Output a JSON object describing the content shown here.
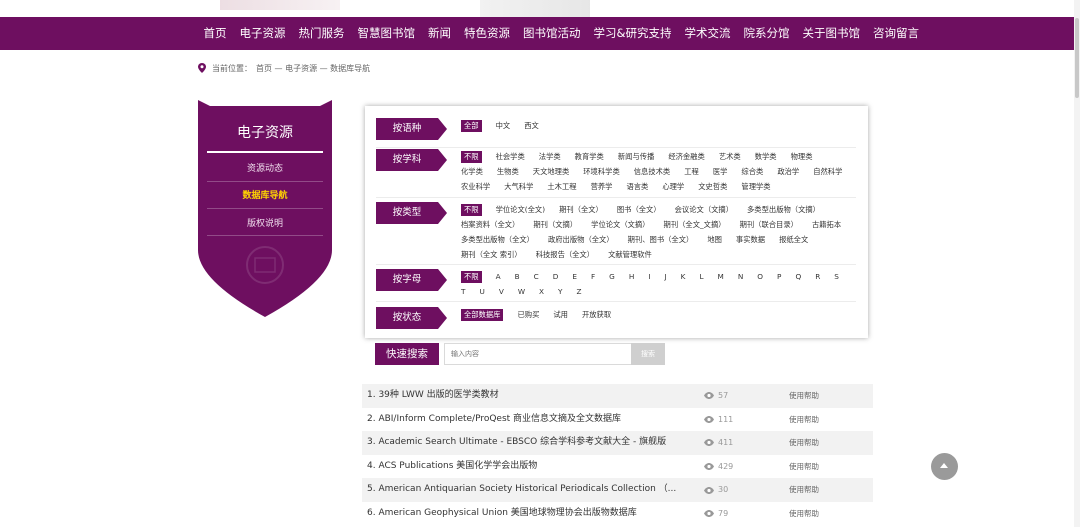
{
  "nav": [
    "首页",
    "电子资源",
    "热门服务",
    "智慧图书馆",
    "新闻",
    "特色资源",
    "图书馆活动",
    "学习&研究支持",
    "学术交流",
    "院系分馆",
    "关于图书馆",
    "咨询留言"
  ],
  "breadcrumb": {
    "prefix": "当前位置：",
    "path": "首页 — 电子资源 — 数据库导航"
  },
  "sidebar": {
    "title": "电子资源",
    "items": [
      {
        "label": "资源动态",
        "active": false
      },
      {
        "label": "数据库导航",
        "active": true
      },
      {
        "label": "版权说明",
        "active": false
      }
    ]
  },
  "filters": {
    "language": {
      "label": "按语种",
      "options": [
        "全部",
        "中文",
        "西文"
      ],
      "selected": "全部"
    },
    "subject": {
      "label": "按学科",
      "options": [
        "不限",
        "社会学类",
        "法学类",
        "教育学类",
        "新闻与传播",
        "经济金融类",
        "艺术类",
        "数学类",
        "物理类",
        "化学类",
        "生物类",
        "天文地理类",
        "环境科学类",
        "信息技术类",
        "工程",
        "医学",
        "综合类",
        "政治学",
        "自然科学",
        "农业科学",
        "大气科学",
        "土木工程",
        "营养学",
        "语言类",
        "心理学",
        "文史哲类",
        "管理学类"
      ],
      "selected": "不限"
    },
    "type": {
      "label": "按类型",
      "options": [
        "不限",
        "学位论文(全文)",
        "期刊（全文）",
        "图书（全文）",
        "会议论文（文摘）",
        "多类型出版物（文摘）",
        "档案资料（全文）",
        "期刊（文摘）",
        "学位论文（文摘）",
        "期刊（全文_文摘）",
        "期刊（联合目录）",
        "古籍拓本",
        "多类型出版物（全文）",
        "政府出版物（全文）",
        "期刊、图书（全文）",
        "地图",
        "事实数据",
        "报纸全文",
        "期刊（全文 索引）",
        "科技报告（全文）",
        "文献管理软件"
      ],
      "selected": "不限"
    },
    "letter": {
      "label": "按字母",
      "options": [
        "不限",
        "A",
        "B",
        "C",
        "D",
        "E",
        "F",
        "G",
        "H",
        "I",
        "J",
        "K",
        "L",
        "M",
        "N",
        "O",
        "P",
        "Q",
        "R",
        "S",
        "T",
        "U",
        "V",
        "W",
        "X",
        "Y",
        "Z"
      ],
      "selected": "不限"
    },
    "status": {
      "label": "按状态",
      "options": [
        "全部数据库",
        "已购买",
        "试用",
        "开放获取"
      ],
      "selected": "全部数据库"
    }
  },
  "search": {
    "label": "快速搜索",
    "placeholder": "输入内容",
    "button": "搜索"
  },
  "databases": [
    {
      "name": "1. 39种 LWW 出版的医学类教材",
      "views": "57",
      "help": "使用帮助"
    },
    {
      "name": "2. ABI/Inform Complete/ProQest 商业信息文摘及全文数据库",
      "views": "111",
      "help": "使用帮助"
    },
    {
      "name": "3. Academic Search Ultimate - EBSCO 综合学科参考文献大全 - 旗舰版",
      "views": "411",
      "help": "使用帮助"
    },
    {
      "name": "4. ACS Publications 美国化学学会出版物",
      "views": "429",
      "help": "使用帮助"
    },
    {
      "name": "5. American Antiquarian Society Historical Periodicals Collection （...",
      "views": "30",
      "help": "使用帮助"
    },
    {
      "name": "6. American Geophysical Union 美国地球物理协会出版物数据库",
      "views": "79",
      "help": "使用帮助"
    }
  ],
  "colors": {
    "brand": "#6e0f60",
    "highlight": "#ffd400"
  }
}
